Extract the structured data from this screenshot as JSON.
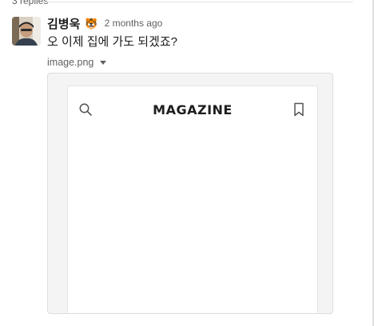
{
  "thread": {
    "replies_label": "3 replies"
  },
  "message": {
    "sender": "김병욱",
    "status_emoji": "🐯",
    "timestamp": "2 months ago",
    "text": "오 이제 집에 가도 되겠죠?",
    "avatar": "user-avatar"
  },
  "attachment": {
    "file_name": "image.png",
    "preview": {
      "title": "MAGAZINE",
      "left_icon": "search-icon",
      "right_icon": "bookmark-icon"
    }
  }
}
